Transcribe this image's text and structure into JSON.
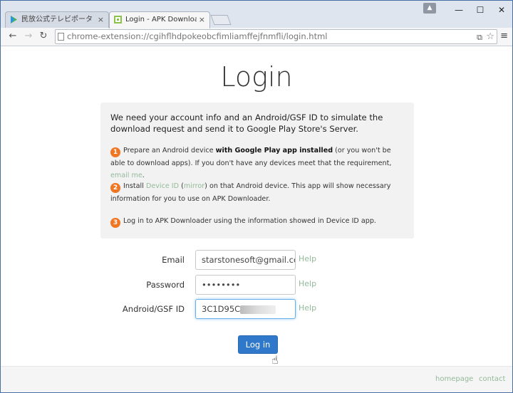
{
  "browser": {
    "tabs": [
      {
        "title": "民放公式テレビポータル「TVe",
        "active": false
      },
      {
        "title": "Login - APK Downloader",
        "active": true
      }
    ],
    "url": "chrome-extension://cgihflhdpokeobcfimliamffejfnmfli/login.html"
  },
  "page": {
    "title": "Login",
    "intro": "We need your account info and an Android/GSF ID to simulate the download request and send it to Google Play Store's Server.",
    "steps": [
      {
        "num": "1",
        "text_before": "Prepare an Android device ",
        "bold": "with Google Play app installed",
        "text_mid": " (or you won't be able to download apps). If you don't have any devices meet that the requirement, ",
        "link": "email me",
        "text_after": "."
      },
      {
        "num": "2",
        "text_before": "Install ",
        "link1": "Device ID",
        "paren_open": " (",
        "link2": "mirror",
        "text_after": ") on that Android device. This app will show necessary information for you to use on APK Downloader."
      },
      {
        "num": "3",
        "text": "Log in to APK Downloader using the information showed in Device ID app."
      }
    ],
    "form": {
      "email_label": "Email",
      "email_value": "starstonesoft@gmail.com",
      "password_label": "Password",
      "password_value": "••••••••",
      "gsf_label": "Android/GSF ID",
      "gsf_value": "3C1D95C97",
      "help": "Help"
    },
    "login_button": "Log in",
    "footer": {
      "homepage": "homepage",
      "contact": "contact"
    }
  },
  "colors": {
    "accent": "#f17623",
    "button": "#3078c9",
    "link": "#93b99a"
  }
}
